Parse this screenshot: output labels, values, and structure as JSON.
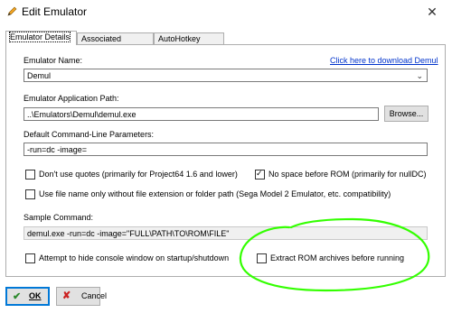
{
  "window": {
    "title": "Edit Emulator",
    "close_glyph": "✕"
  },
  "tabs": [
    {
      "label": "Emulator Details"
    },
    {
      "label": "Associated Platforms"
    },
    {
      "label": "AutoHotkey Script"
    }
  ],
  "emulator_name": {
    "label": "Emulator Name:",
    "value": "Demul",
    "download_link": "Click here to download Demul"
  },
  "application_path": {
    "label": "Emulator Application Path:",
    "value": "..\\Emulators\\Demul\\demul.exe",
    "browse_label": "Browse..."
  },
  "command_line": {
    "label": "Default Command-Line Parameters:",
    "value": "-run=dc -image="
  },
  "options": {
    "dont_use_quotes": {
      "label": "Don't use quotes (primarily for Project64 1.6 and lower)",
      "checked": false
    },
    "no_space_before_rom": {
      "label": "No space before ROM (primarily for nullDC)",
      "checked": true
    },
    "file_name_only": {
      "label": "Use file name only without file extension or folder path (Sega Model 2 Emulator, etc. compatibility)",
      "checked": false
    },
    "hide_console": {
      "label": "Attempt to hide console window on startup/shutdown",
      "checked": false
    },
    "extract_rom": {
      "label": "Extract ROM archives before running",
      "checked": false
    }
  },
  "sample_command": {
    "label": "Sample Command:",
    "value": "demul.exe -run=dc -image=\"FULL\\PATH\\TO\\ROM\\FILE\""
  },
  "buttons": {
    "ok": "OK",
    "cancel": "Cancel"
  },
  "colors": {
    "annotation": "#33ff00",
    "link": "#0033cc",
    "ok_border": "#0078d7"
  }
}
